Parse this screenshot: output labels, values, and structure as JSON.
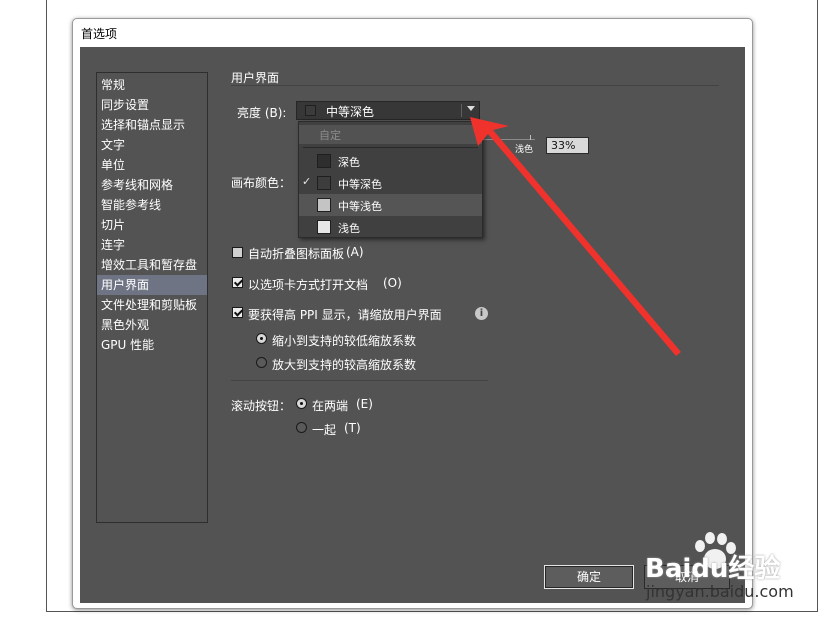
{
  "window": {
    "title": "首选项"
  },
  "sidebar": {
    "items": [
      {
        "label": "常规"
      },
      {
        "label": "同步设置"
      },
      {
        "label": "选择和锚点显示"
      },
      {
        "label": "文字"
      },
      {
        "label": "单位"
      },
      {
        "label": "参考线和网格"
      },
      {
        "label": "智能参考线"
      },
      {
        "label": "切片"
      },
      {
        "label": "连字"
      },
      {
        "label": "增效工具和暂存盘"
      },
      {
        "label": "用户界面",
        "selected": true
      },
      {
        "label": "文件处理和剪贴板"
      },
      {
        "label": "黑色外观"
      },
      {
        "label": "GPU 性能"
      }
    ]
  },
  "main": {
    "section_title": "用户界面",
    "brightness": {
      "label": "亮度 (B):",
      "value": "中等深色",
      "value_swatch": "#3b3b3b",
      "slider_label": "浅色",
      "percent": "33%"
    },
    "dropdown": {
      "header": "自定",
      "options": [
        {
          "label": "深色",
          "swatch": "#2e2e2e",
          "checked": false,
          "highlighted": false
        },
        {
          "label": "中等深色",
          "swatch": "#3d3d3d",
          "checked": true,
          "highlighted": false
        },
        {
          "label": "中等浅色",
          "swatch": "#c4c4c4",
          "checked": false,
          "highlighted": true
        },
        {
          "label": "浅色",
          "swatch": "#e6e6e6",
          "checked": false,
          "highlighted": false
        }
      ],
      "check_mark": "✓"
    },
    "canvas_color": {
      "label": "画布颜色："
    },
    "auto_collapse": {
      "label": "自动折叠图标面板",
      "suffix": "(A)",
      "checked": false
    },
    "open_tabs": {
      "label": "以选项卡方式打开文档",
      "shortcut": "(O)",
      "checked": true
    },
    "high_ppi": {
      "label": "要获得高 PPI 显示，请缩放用户界面",
      "checked": true,
      "info_icon": "info-icon"
    },
    "scale_options": [
      {
        "label": "缩小到支持的较低缩放系数",
        "selected": true
      },
      {
        "label": "放大到支持的较高缩放系数",
        "selected": false
      }
    ],
    "scroll_buttons": {
      "label": "滚动按钮：",
      "options": [
        {
          "label": "在两端",
          "shortcut": "(E)",
          "selected": true
        },
        {
          "label": "一起",
          "shortcut": "(T)",
          "selected": false
        }
      ]
    }
  },
  "footer": {
    "ok_label": "确定",
    "cancel_label": "取消"
  },
  "annotation": {
    "arrow_color": "#f0322d"
  },
  "watermark": {
    "brand": "Baidu经验",
    "url": "jingyan.baidu.com"
  }
}
